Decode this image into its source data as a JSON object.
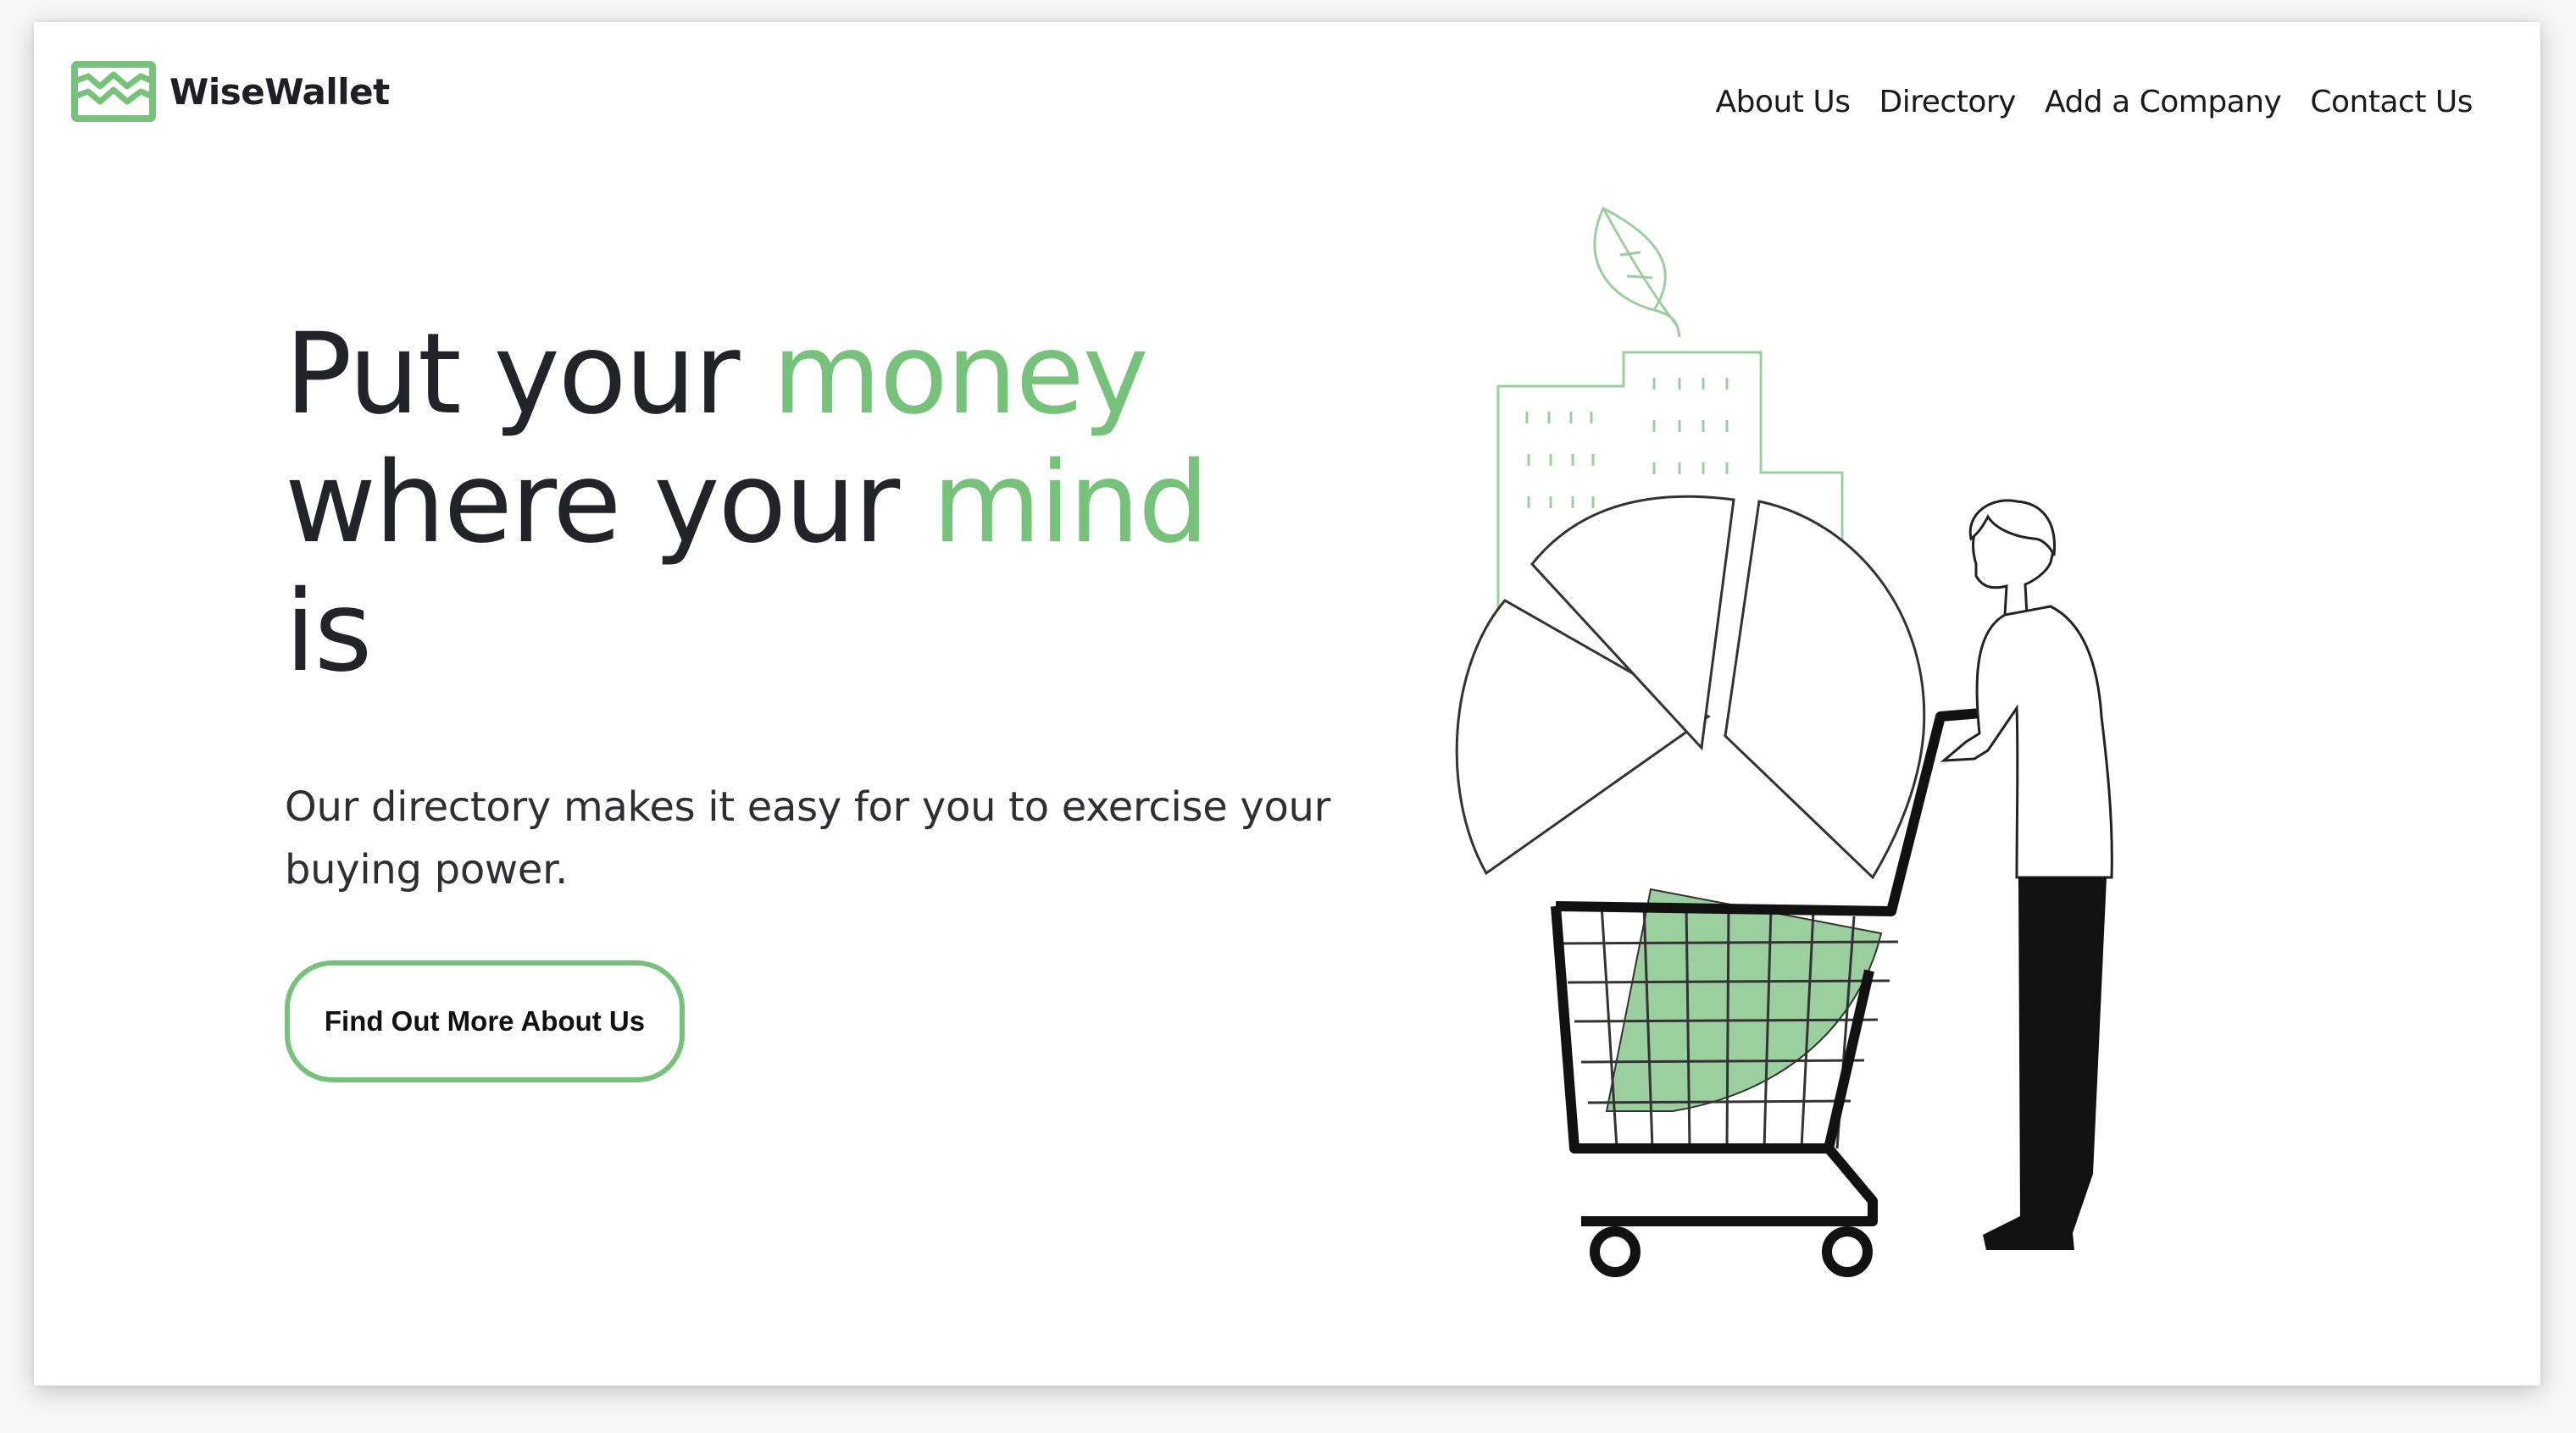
{
  "brand": {
    "name": "WiseWallet",
    "accent_color": "#77c27b",
    "logo_icon": "wallet-wave-icon"
  },
  "nav": {
    "items": [
      {
        "label": "About Us"
      },
      {
        "label": "Directory"
      },
      {
        "label": "Add a Company"
      },
      {
        "label": "Contact Us"
      }
    ]
  },
  "hero": {
    "headline_parts": [
      "Put your ",
      "money",
      "where your ",
      "mind",
      "is"
    ],
    "subtext": "Our directory makes it easy for you to exercise your buying power.",
    "cta_label": "Find Out More About Us",
    "illustration": "person-shopping-cart-pie-chart-city-leaf"
  }
}
